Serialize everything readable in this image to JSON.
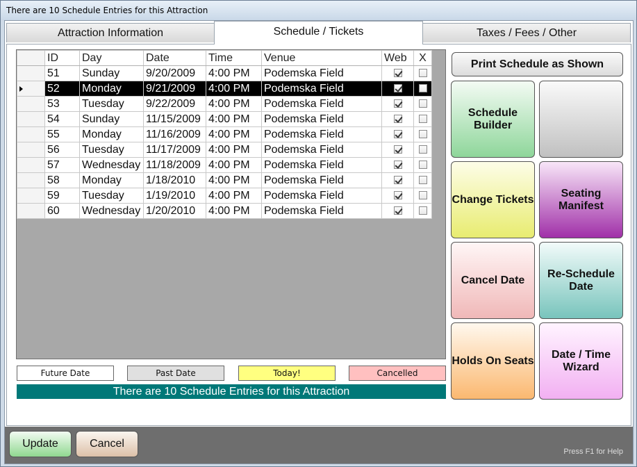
{
  "window": {
    "title": "There are 10 Schedule Entries for this Attraction"
  },
  "tabs": [
    {
      "label": "Attraction Information"
    },
    {
      "label": "Schedule / Tickets"
    },
    {
      "label": "Taxes / Fees / Other"
    }
  ],
  "grid": {
    "columns": [
      "ID",
      "Day",
      "Date",
      "Time",
      "Venue",
      "Web",
      "X"
    ],
    "selected_row": 1,
    "rows": [
      {
        "id": "51",
        "day": "Sunday",
        "date": "9/20/2009",
        "time": "4:00 PM",
        "venue": "Podemska Field",
        "web": true,
        "x": false
      },
      {
        "id": "52",
        "day": "Monday",
        "date": "9/21/2009",
        "time": "4:00 PM",
        "venue": "Podemska Field",
        "web": true,
        "x": false
      },
      {
        "id": "53",
        "day": "Tuesday",
        "date": "9/22/2009",
        "time": "4:00 PM",
        "venue": "Podemska Field",
        "web": true,
        "x": false
      },
      {
        "id": "54",
        "day": "Sunday",
        "date": "11/15/2009",
        "time": "4:00 PM",
        "venue": "Podemska Field",
        "web": true,
        "x": false
      },
      {
        "id": "55",
        "day": "Monday",
        "date": "11/16/2009",
        "time": "4:00 PM",
        "venue": "Podemska Field",
        "web": true,
        "x": false
      },
      {
        "id": "56",
        "day": "Tuesday",
        "date": "11/17/2009",
        "time": "4:00 PM",
        "venue": "Podemska Field",
        "web": true,
        "x": false
      },
      {
        "id": "57",
        "day": "Wednesday",
        "date": "11/18/2009",
        "time": "4:00 PM",
        "venue": "Podemska Field",
        "web": true,
        "x": false
      },
      {
        "id": "58",
        "day": "Monday",
        "date": "1/18/2010",
        "time": "4:00 PM",
        "venue": "Podemska Field",
        "web": true,
        "x": false
      },
      {
        "id": "59",
        "day": "Tuesday",
        "date": "1/19/2010",
        "time": "4:00 PM",
        "venue": "Podemska Field",
        "web": true,
        "x": false
      },
      {
        "id": "60",
        "day": "Wednesday",
        "date": "1/20/2010",
        "time": "4:00 PM",
        "venue": "Podemska Field",
        "web": true,
        "x": false
      }
    ]
  },
  "legend": {
    "future": {
      "label": "Future Date",
      "color": "#ffffff"
    },
    "past": {
      "label": "Past Date",
      "color": "#e0e0e0"
    },
    "today": {
      "label": "Today!",
      "color": "#ffff80"
    },
    "cancelled": {
      "label": "Cancelled",
      "color": "#ffc0c0"
    }
  },
  "status_banner": "There are 10 Schedule Entries for this Attraction",
  "actions": {
    "print": "Print Schedule as Shown",
    "schedule_builder": "Schedule Builder",
    "blank": "",
    "change_tickets": "Change Tickets",
    "seating_manifest": "Seating Manifest",
    "cancel_date": "Cancel Date",
    "reschedule_date": "Re-Schedule Date",
    "holds_on_seats": "Holds On Seats",
    "date_time_wizard": "Date / Time Wizard"
  },
  "footer": {
    "update": "Update",
    "cancel": "Cancel",
    "help": "Press F1 for Help"
  },
  "colors": {
    "banner": "#007878",
    "green": "#8ed69a",
    "yellow": "#eef080",
    "purple": "#a030a8",
    "pink": "#f4c0c0",
    "teal": "#7cc8c0",
    "orange": "#fbbf78",
    "magenta": "#f4b8f4"
  }
}
